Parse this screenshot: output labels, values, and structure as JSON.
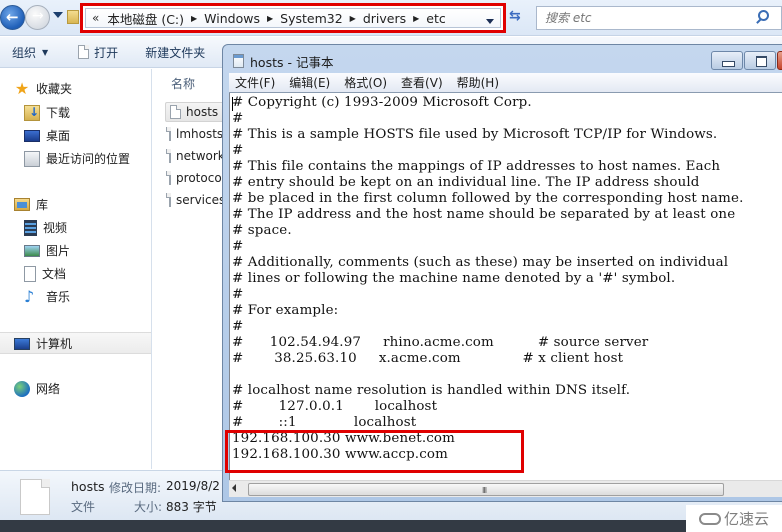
{
  "explorer": {
    "breadcrumb": {
      "overflow": "«",
      "items": [
        "本地磁盘 (C:)",
        "Windows",
        "System32",
        "drivers",
        "etc"
      ]
    },
    "search": {
      "placeholder": "搜索 etc"
    },
    "toolbar": {
      "organize": "组织",
      "open": "打开",
      "new_folder": "新建文件夹"
    },
    "sidebar": {
      "favorites": "收藏夹",
      "favorites_items": [
        "下载",
        "桌面",
        "最近访问的位置"
      ],
      "libraries": "库",
      "library_items": [
        "视频",
        "图片",
        "文档",
        "音乐"
      ],
      "computer": "计算机",
      "network": "网络"
    },
    "filelist": {
      "column_name": "名称",
      "files": [
        "hosts",
        "lmhosts.sam",
        "networks",
        "protocol",
        "services"
      ],
      "selected": "hosts"
    },
    "details": {
      "name": "hosts",
      "modified_label": "修改日期:",
      "modified_value": "2019/8/2",
      "type": "文件",
      "size_label": "大小:",
      "size_value": "883 字节"
    }
  },
  "notepad": {
    "title": "hosts - 记事本",
    "menu": [
      "文件(F)",
      "编辑(E)",
      "格式(O)",
      "查看(V)",
      "帮助(H)"
    ],
    "lines": [
      "# Copyright (c) 1993-2009 Microsoft Corp.",
      "#",
      "# This is a sample HOSTS file used by Microsoft TCP/IP for Windows.",
      "#",
      "# This file contains the mappings of IP addresses to host names. Each",
      "# entry should be kept on an individual line. The IP address should",
      "# be placed in the first column followed by the corresponding host name.",
      "# The IP address and the host name should be separated by at least one",
      "# space.",
      "#",
      "# Additionally, comments (such as these) may be inserted on individual",
      "# lines or following the machine name denoted by a '#' symbol.",
      "#",
      "# For example:",
      "#",
      "#      102.54.94.97     rhino.acme.com          # source server",
      "#       38.25.63.10     x.acme.com              # x client host",
      "",
      "# localhost name resolution is handled within DNS itself.",
      "#\t127.0.0.1       localhost",
      "#\t::1             localhost",
      "192.168.100.30 www.benet.com",
      "192.168.100.30 www.accp.com"
    ],
    "scroll_grip": "III"
  },
  "watermark": "亿速云",
  "colors": {
    "highlight": "#e00000",
    "title_bar": "#c4d7ee"
  }
}
